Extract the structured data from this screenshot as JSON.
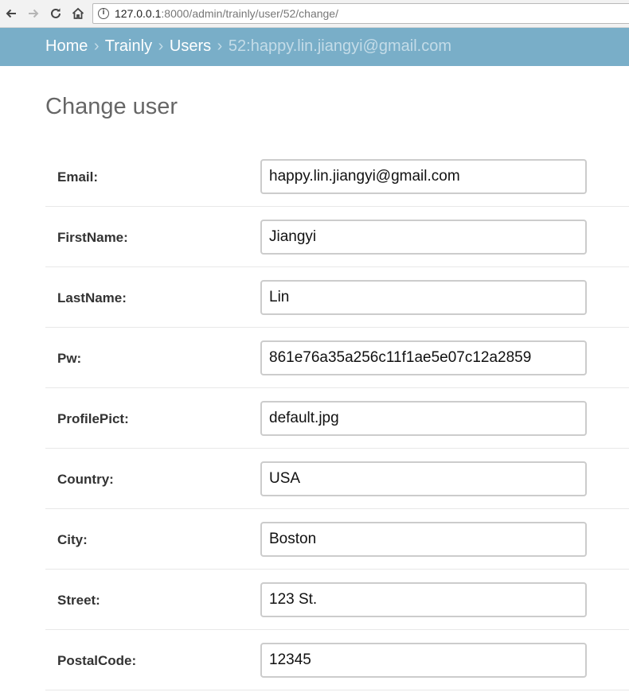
{
  "browser": {
    "url_host": "127.0.0.1",
    "url_rest": ":8000/admin/trainly/user/52/change/"
  },
  "breadcrumbs": {
    "home": "Home",
    "app": "Trainly",
    "model": "Users",
    "current": "52:happy.lin.jiangyi@gmail.com",
    "separator": "›"
  },
  "page_title": "Change user",
  "fields": [
    {
      "label": "Email:",
      "value": "happy.lin.jiangyi@gmail.com"
    },
    {
      "label": "FirstName:",
      "value": "Jiangyi"
    },
    {
      "label": "LastName:",
      "value": "Lin"
    },
    {
      "label": "Pw:",
      "value": "861e76a35a256c11f1ae5e07c12a2859"
    },
    {
      "label": "ProfilePict:",
      "value": "default.jpg"
    },
    {
      "label": "Country:",
      "value": "USA"
    },
    {
      "label": "City:",
      "value": "Boston"
    },
    {
      "label": "Street:",
      "value": "123 St."
    },
    {
      "label": "PostalCode:",
      "value": "12345"
    }
  ],
  "colors": {
    "breadcrumb_bg": "#79aec8",
    "link": "#ffffff"
  }
}
